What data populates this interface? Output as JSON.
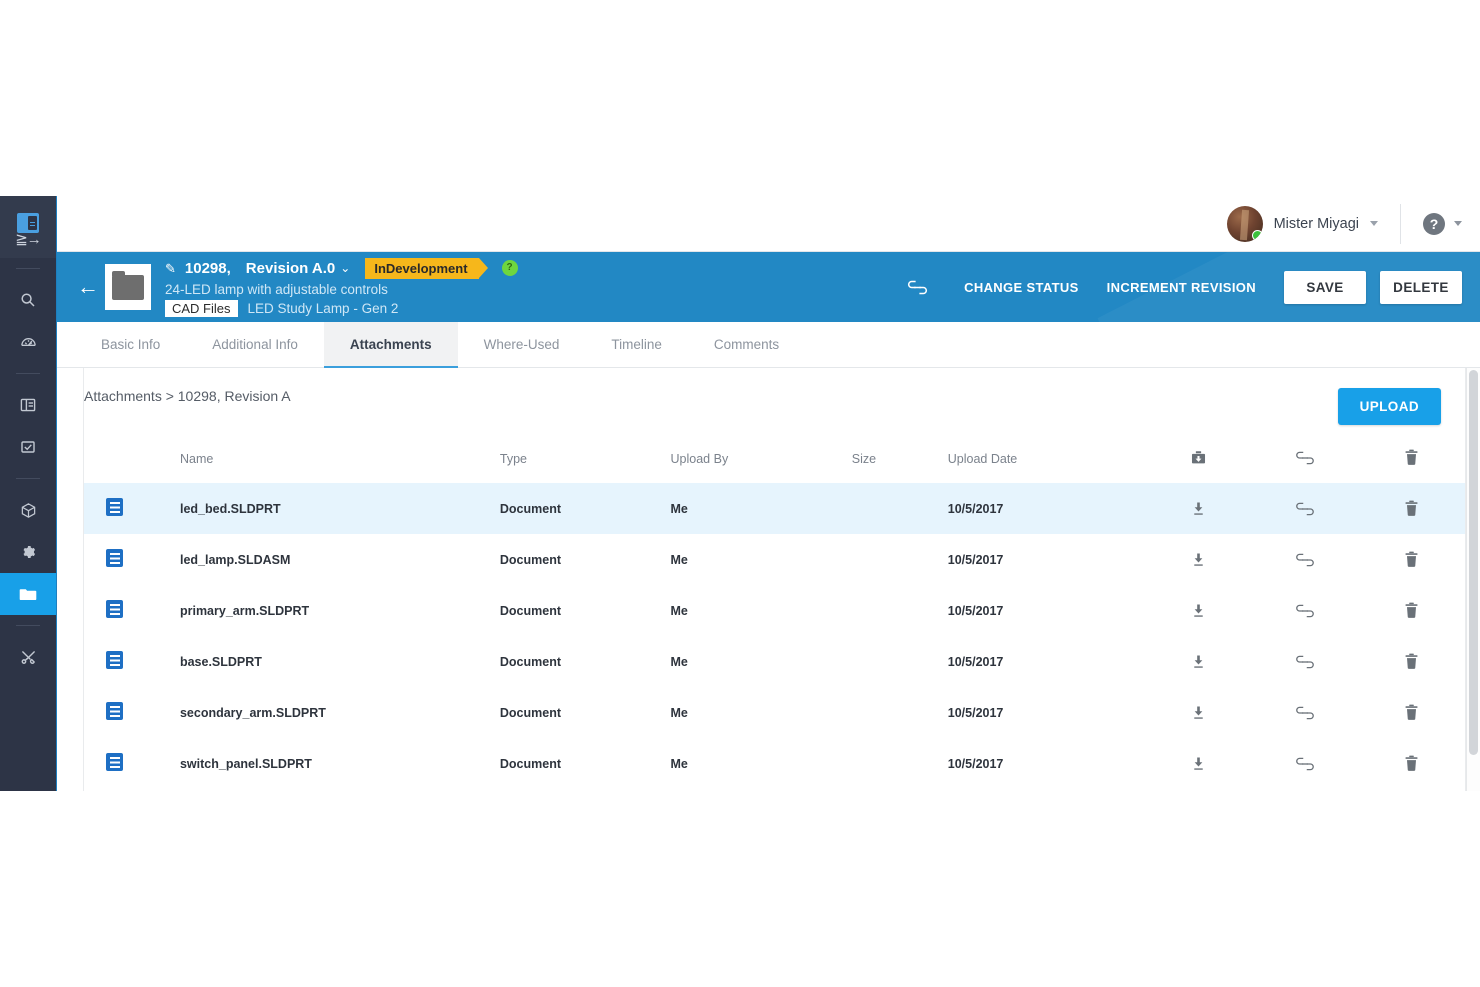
{
  "sidebar": {
    "logo_name": "app-logo",
    "items": [
      {
        "name": "search",
        "icon": "search-icon",
        "active": false
      },
      {
        "name": "dashboard",
        "icon": "gauge-icon",
        "active": false
      },
      {
        "name": "projects",
        "icon": "board-icon",
        "active": false
      },
      {
        "name": "tasks",
        "icon": "checkbox-icon",
        "active": false
      },
      {
        "name": "parts",
        "icon": "cube-icon",
        "active": false
      },
      {
        "name": "settings",
        "icon": "gear-icon",
        "active": false
      },
      {
        "name": "files",
        "icon": "folder-icon",
        "active": true
      },
      {
        "name": "tools",
        "icon": "tools-icon",
        "active": false
      }
    ]
  },
  "topbar": {
    "user_name": "Mister Miyagi",
    "user_caret": "▾",
    "help_label": "?",
    "help_caret": "▾"
  },
  "object_header": {
    "back_arrow": "←",
    "edit_icon": "✎",
    "id": "10298,",
    "revision": "Revision A.0",
    "revision_caret": "⌄",
    "status": "InDevelopment",
    "status_help": "?",
    "description": "24-LED lamp with adjustable controls",
    "chip": "CAD Files",
    "parent": "LED Study Lamp - Gen 2",
    "link_icon": "link-icon",
    "actions": [
      {
        "label": "CHANGE STATUS",
        "style": "text"
      },
      {
        "label": "INCREMENT REVISION",
        "style": "text"
      },
      {
        "label": "SAVE",
        "style": "white"
      },
      {
        "label": "DELETE",
        "style": "white"
      }
    ],
    "accent_color": "#2288c4",
    "status_color": "#f6b71b"
  },
  "tabs": [
    {
      "label": "Basic Info",
      "active": false
    },
    {
      "label": "Additional Info",
      "active": false
    },
    {
      "label": "Attachments",
      "active": true
    },
    {
      "label": "Where-Used",
      "active": false
    },
    {
      "label": "Timeline",
      "active": false
    },
    {
      "label": "Comments",
      "active": false
    }
  ],
  "panel": {
    "breadcrumb": "Attachments > 10298, Revision A",
    "upload_label": "UPLOAD",
    "upload_color": "#18a0e8"
  },
  "table": {
    "headers": {
      "icon": "",
      "name": "Name",
      "type": "Type",
      "upload_by": "Upload By",
      "size": "Size",
      "upload_date": "Upload Date",
      "download_all": "download-all-icon",
      "link_all": "link-icon",
      "delete_all": "trash-icon"
    },
    "rows": [
      {
        "icon": "document-icon",
        "name": "led_bed.SLDPRT",
        "type": "Document",
        "upload_by": "Me",
        "size": "",
        "upload_date": "10/5/2017",
        "selected": true
      },
      {
        "icon": "document-icon",
        "name": "led_lamp.SLDASM",
        "type": "Document",
        "upload_by": "Me",
        "size": "",
        "upload_date": "10/5/2017",
        "selected": false
      },
      {
        "icon": "document-icon",
        "name": "primary_arm.SLDPRT",
        "type": "Document",
        "upload_by": "Me",
        "size": "",
        "upload_date": "10/5/2017",
        "selected": false
      },
      {
        "icon": "document-icon",
        "name": "base.SLDPRT",
        "type": "Document",
        "upload_by": "Me",
        "size": "",
        "upload_date": "10/5/2017",
        "selected": false
      },
      {
        "icon": "document-icon",
        "name": "secondary_arm.SLDPRT",
        "type": "Document",
        "upload_by": "Me",
        "size": "",
        "upload_date": "10/5/2017",
        "selected": false
      },
      {
        "icon": "document-icon",
        "name": "switch_panel.SLDPRT",
        "type": "Document",
        "upload_by": "Me",
        "size": "",
        "upload_date": "10/5/2017",
        "selected": false
      }
    ],
    "row_actions": {
      "download": "download-icon",
      "link": "link-icon",
      "delete": "trash-icon"
    },
    "selected_row_color": "#e6f4fd"
  }
}
